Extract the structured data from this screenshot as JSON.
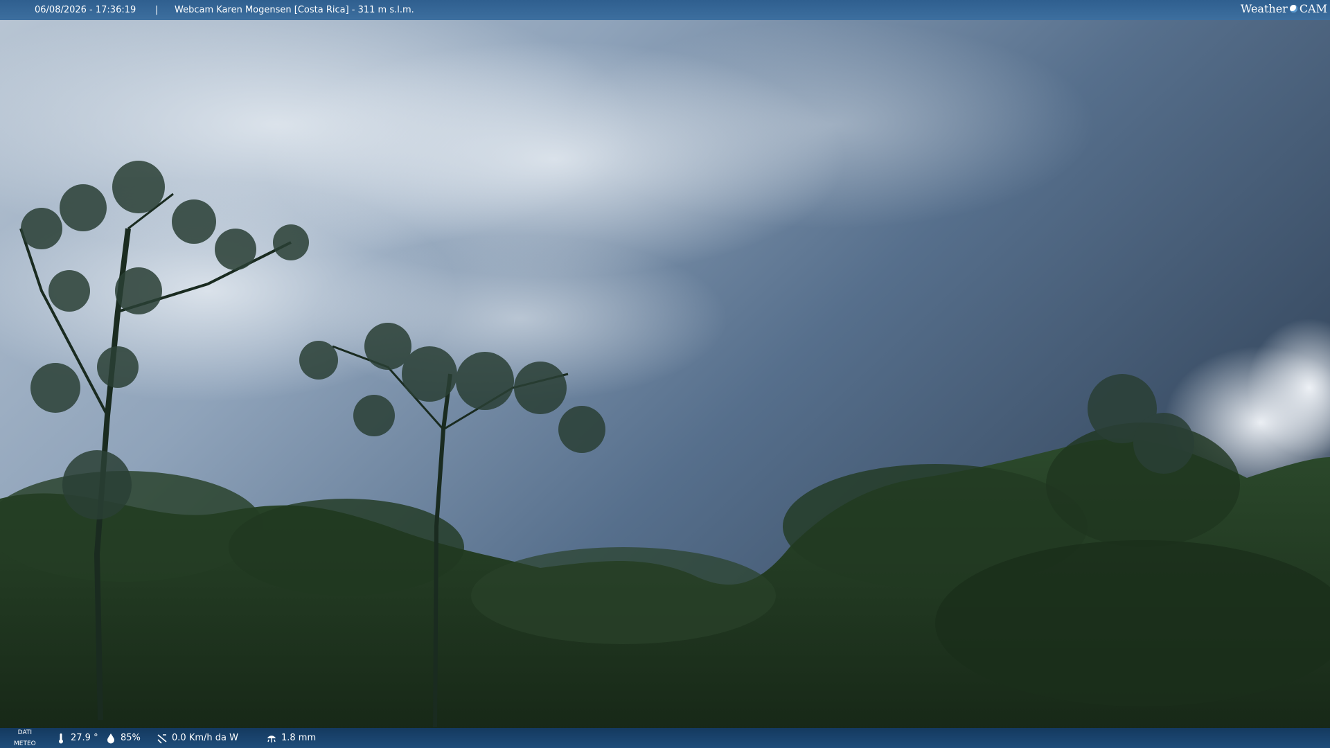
{
  "header": {
    "datetime": "06/08/2026 - 17:36:19",
    "separator": "|",
    "camera": "Webcam Karen Mogensen [Costa Rica] - 311 m s.l.m.",
    "logo_left": "Weather",
    "logo_right": "CAM"
  },
  "footer": {
    "label_line1": "DATI",
    "label_line2": "METEO",
    "temperature": "27.9 °",
    "humidity": "85%",
    "wind": "0.0 Km/h da W",
    "rain": "1.8 mm"
  },
  "icons": {
    "temperature": "thermometer-icon",
    "humidity": "humidity-drop-icon",
    "wind": "wind-icon",
    "rain": "rain-gauge-icon"
  },
  "colors": {
    "topbar": "#3d6f9f",
    "bottombar": "#1f4d7a",
    "sky": "#4a6686",
    "foliage": "#1e3320"
  }
}
